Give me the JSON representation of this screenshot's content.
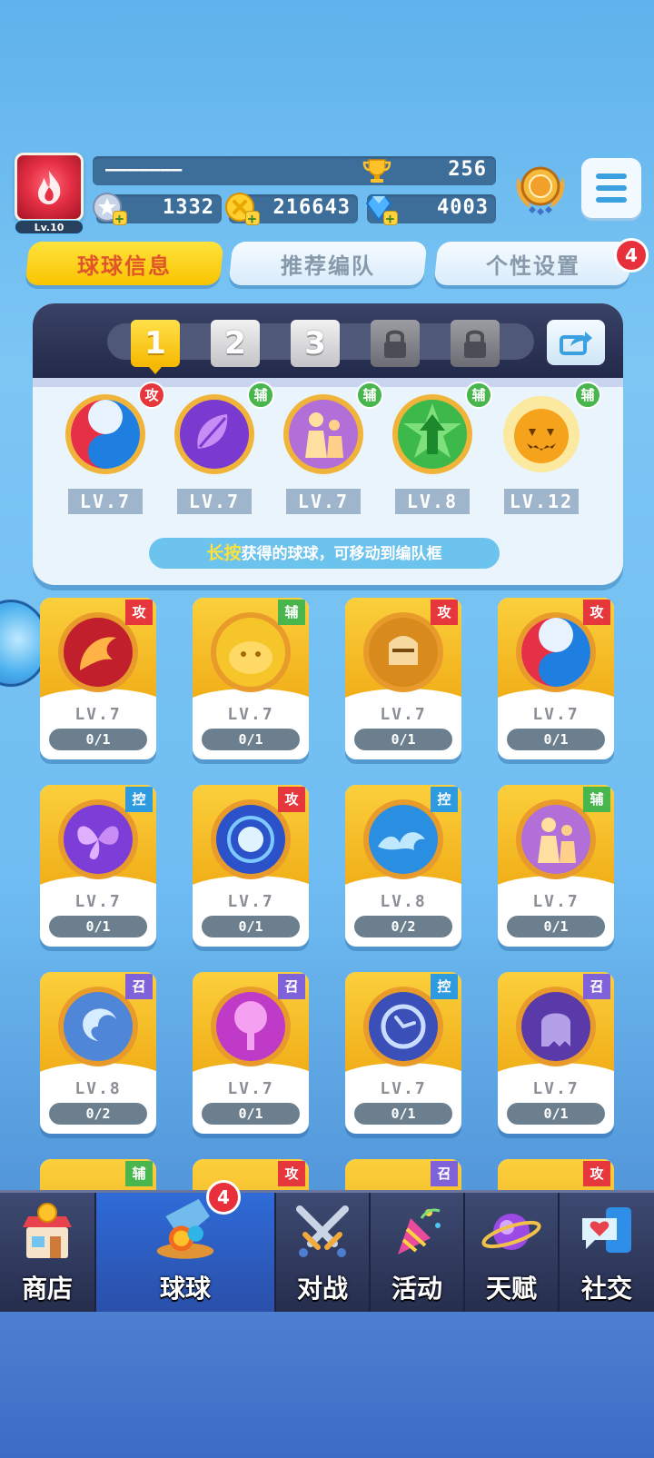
{
  "player": {
    "name": "———————",
    "level": "Lv.10",
    "trophies": "256"
  },
  "currencies": [
    {
      "icon": "star-coin-icon",
      "value": "1332"
    },
    {
      "icon": "gold-coin-icon",
      "value": "216643"
    },
    {
      "icon": "diamond-icon",
      "value": "4003"
    }
  ],
  "tabs": [
    {
      "label": "球球信息",
      "active": true
    },
    {
      "label": "推荐编队",
      "active": false
    },
    {
      "label": "个性设置",
      "active": false,
      "badge": "4"
    }
  ],
  "team": {
    "slots": [
      "1",
      "2",
      "3",
      "",
      ""
    ],
    "selected_slot": "1",
    "members": [
      {
        "icon": "taiji-ball-icon",
        "tag": "攻",
        "level": "LV.7"
      },
      {
        "icon": "leaf-ball-icon",
        "tag": "辅",
        "level": "LV.7"
      },
      {
        "icon": "crowd-ball-icon",
        "tag": "辅",
        "level": "LV.7"
      },
      {
        "icon": "star-arrow-ball-icon",
        "tag": "辅",
        "level": "LV.8"
      },
      {
        "icon": "pumpkin-ball-icon",
        "tag": "辅",
        "level": "LV.12"
      }
    ],
    "hint_highlight": "长按",
    "hint_text": "获得的球球，可移动到编队框"
  },
  "collection": [
    {
      "icon": "dragon-ball-icon",
      "tag": "攻",
      "level": "LV.7",
      "count": "0/1"
    },
    {
      "icon": "piggy-ball-icon",
      "tag": "辅",
      "level": "LV.7",
      "count": "0/1"
    },
    {
      "icon": "knight-ball-icon",
      "tag": "攻",
      "level": "LV.7",
      "count": "0/1"
    },
    {
      "icon": "taiji-ball-icon",
      "tag": "攻",
      "level": "LV.7",
      "count": "0/1"
    },
    {
      "icon": "butterfly-ball-icon",
      "tag": "控",
      "level": "LV.7",
      "count": "0/1"
    },
    {
      "icon": "energy-ball-icon",
      "tag": "攻",
      "level": "LV.7",
      "count": "0/1"
    },
    {
      "icon": "wave-ball-icon",
      "tag": "控",
      "level": "LV.8",
      "count": "0/2"
    },
    {
      "icon": "crowd-ball-icon",
      "tag": "辅",
      "level": "LV.7",
      "count": "0/1"
    },
    {
      "icon": "vortex-ball-icon",
      "tag": "召",
      "level": "LV.8",
      "count": "0/2"
    },
    {
      "icon": "tree-ball-icon",
      "tag": "召",
      "level": "LV.7",
      "count": "0/1"
    },
    {
      "icon": "clock-ball-icon",
      "tag": "控",
      "level": "LV.7",
      "count": "0/1"
    },
    {
      "icon": "ghost-ball-icon",
      "tag": "召",
      "level": "LV.7",
      "count": "0/1"
    }
  ],
  "collection_partial_row": [
    "辅",
    "攻",
    "召",
    "攻"
  ],
  "nav": [
    {
      "label": "商店",
      "icon": "shop-icon",
      "active": false
    },
    {
      "label": "球球",
      "icon": "balls-icon",
      "active": true,
      "badge": "4"
    },
    {
      "label": "对战",
      "icon": "crossed-swords-icon",
      "active": false
    },
    {
      "label": "活动",
      "icon": "party-popper-icon",
      "active": false
    },
    {
      "label": "天赋",
      "icon": "planet-icon",
      "active": false
    },
    {
      "label": "社交",
      "icon": "chat-heart-icon",
      "active": false
    }
  ],
  "colors": {
    "attack": "#e6373d",
    "support": "#49b54d",
    "control": "#2e9be0",
    "summon": "#7f62d9",
    "active_tab": "#f9c400"
  }
}
